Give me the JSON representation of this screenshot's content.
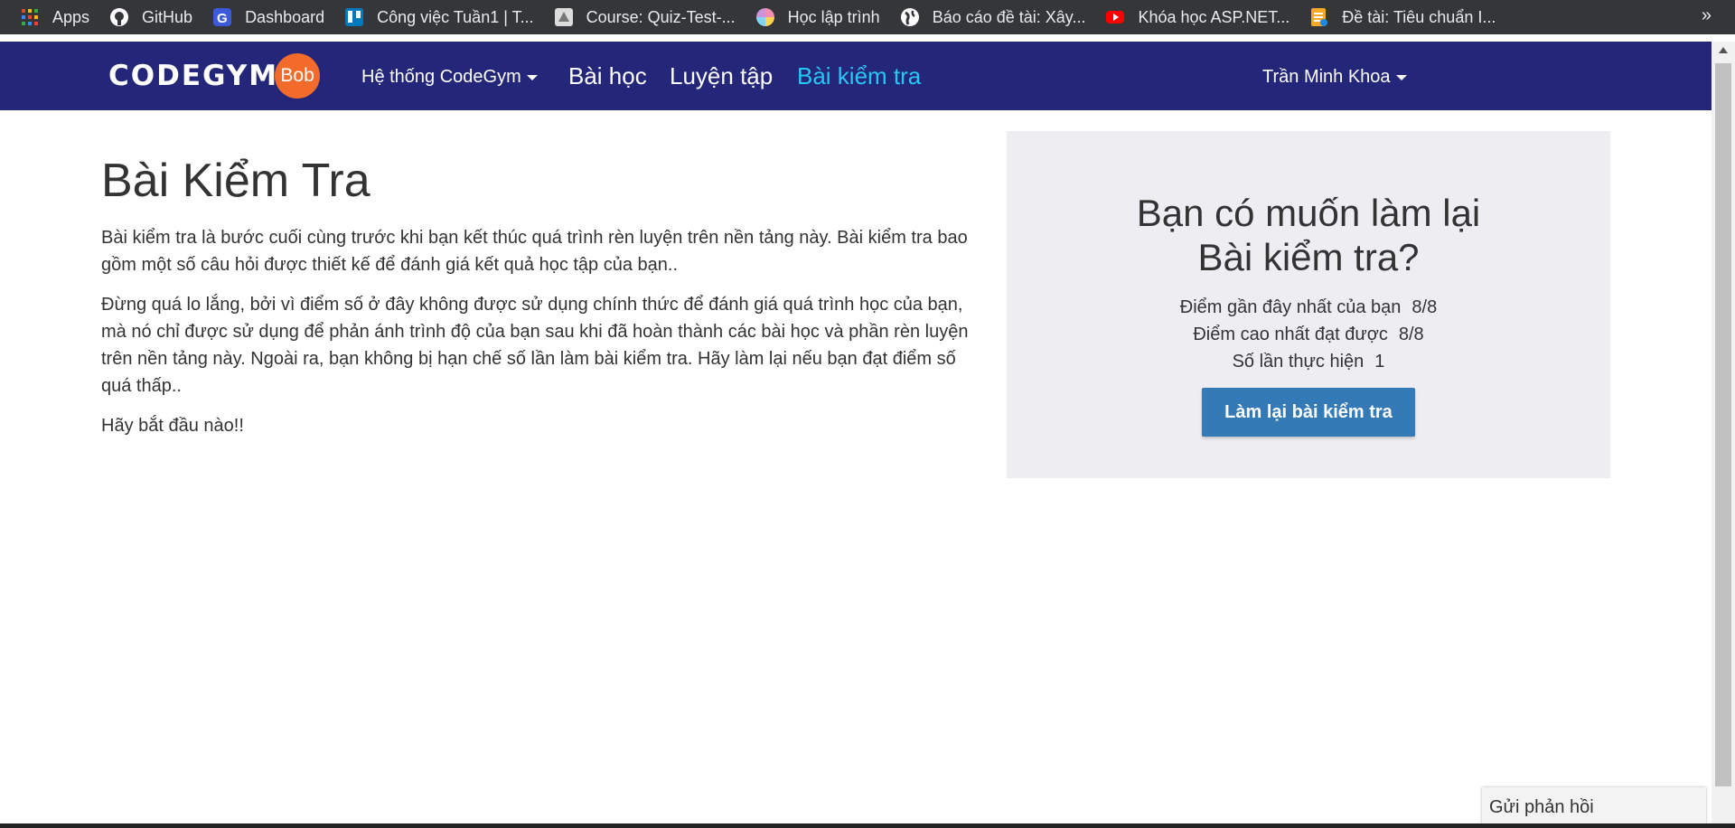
{
  "bookmarks": [
    {
      "label": "Apps",
      "icon": "apps-grid-icon"
    },
    {
      "label": "GitHub",
      "icon": "github-icon"
    },
    {
      "label": "Dashboard",
      "icon": "dashboard-icon"
    },
    {
      "label": "Công việc Tuần1 | T...",
      "icon": "trello-icon"
    },
    {
      "label": "Course: Quiz-Test-...",
      "icon": "course-icon"
    },
    {
      "label": "Học lập trình",
      "icon": "colorful-circle-icon"
    },
    {
      "label": "Báo cáo đề tài: Xây...",
      "icon": "globe-icon"
    },
    {
      "label": "Khóa học ASP.NET...",
      "icon": "youtube-icon"
    },
    {
      "label": "Đề tài: Tiêu chuẩn I...",
      "icon": "doc-icon"
    }
  ],
  "bookmarks_more": "»",
  "navbar": {
    "logo_text": "CODEGYM",
    "logo_badge": "Bob",
    "system_label": "Hệ thống CodeGym",
    "lessons_label": "Bài học",
    "practice_label": "Luyện tập",
    "tests_label": "Bài kiểm tra",
    "user_name": "Trần Minh Khoa",
    "active_color": "#27c7f3",
    "bar_color": "#232679"
  },
  "main": {
    "title": "Bài Kiểm Tra",
    "paragraphs": [
      "Bài kiểm tra là bước cuối cùng trước khi bạn kết thúc quá trình rèn luyện trên nền tảng này. Bài kiểm tra bao gồm một số câu hỏi được thiết kế để đánh giá kết quả học tập của bạn..",
      "Đừng quá lo lắng, bởi vì điểm số ở đây không được sử dụng chính thức để đánh giá quá trình học của bạn, mà nó chỉ được sử dụng để phản ánh trình độ của bạn sau khi đã hoàn thành các bài học và phần rèn luyện trên nền tảng này. Ngoài ra, bạn không bị hạn chế số lần làm bài kiểm tra. Hãy làm lại nếu bạn đạt điểm số quá thấp..",
      "Hãy bắt đầu nào!!"
    ]
  },
  "panel": {
    "heading_line1": "Bạn có muốn làm lại",
    "heading_line2": "Bài kiểm tra?",
    "recent_label": "Điểm gần đây nhất của bạn",
    "recent_value": "8/8",
    "best_label": "Điểm cao nhất đạt được",
    "best_value": "8/8",
    "attempts_label": "Số lần thực hiện",
    "attempts_value": "1",
    "retry_button": "Làm lại bài kiểm tra",
    "button_color": "#337ab7"
  },
  "feedback_label": "Gửi phản hồi"
}
